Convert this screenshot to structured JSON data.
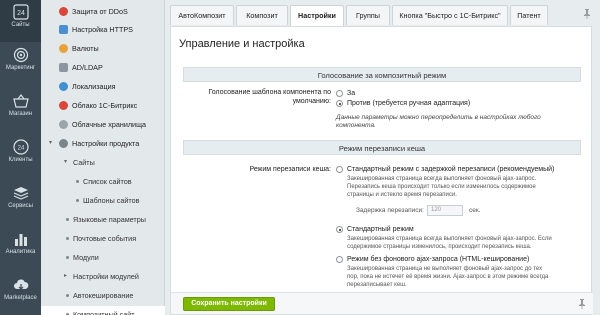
{
  "rail": {
    "items": [
      {
        "label": "Сайты",
        "icon": "grid-24-icon"
      },
      {
        "label": "Маркетинг",
        "icon": "target-icon"
      },
      {
        "label": "Магазин",
        "icon": "basket-icon"
      },
      {
        "label": "Клиенты",
        "icon": "clients-24-icon"
      },
      {
        "label": "Сервисы",
        "icon": "layers-icon"
      },
      {
        "label": "Аналитика",
        "icon": "bar-chart-icon"
      },
      {
        "label": "Marketplace",
        "icon": "cloud-download-icon"
      }
    ],
    "badge_24": "24"
  },
  "menu": {
    "items": [
      {
        "label": "Защита от DDoS"
      },
      {
        "label": "Настройка HTTPS"
      },
      {
        "label": "Валюты"
      },
      {
        "label": "AD/LDAP"
      },
      {
        "label": "Локализация"
      },
      {
        "label": "Облако 1С-Битрикс"
      },
      {
        "label": "Облачные хранилища"
      },
      {
        "label": "Настройки продукта"
      },
      {
        "label": "Сайты"
      },
      {
        "label": "Список сайтов"
      },
      {
        "label": "Шаблоны сайтов"
      },
      {
        "label": "Языковые параметры"
      },
      {
        "label": "Почтовые события"
      },
      {
        "label": "Модули"
      },
      {
        "label": "Настройки модулей"
      },
      {
        "label": "Автокеширование"
      },
      {
        "label": "Композитный сайт"
      }
    ]
  },
  "tabs": [
    {
      "label": "АвтоКомпозит"
    },
    {
      "label": "Композит"
    },
    {
      "label": "Настройки"
    },
    {
      "label": "Группы"
    },
    {
      "label": "Кнопка \"Быстро с 1С-Битрикс\""
    },
    {
      "label": "Патент"
    }
  ],
  "panel": {
    "title": "Управление и настройка",
    "section1": "Голосование за композитный режим",
    "vote_label_1": "Голосование шаблона компонента по",
    "vote_label_2": "умолчанию:",
    "vote_opt_yes": "За",
    "vote_opt_no": "Против (требуется ручная адаптация)",
    "vote_hint_1": "Данные параметры можно переопределить в настройках любого",
    "vote_hint_2": "компонента.",
    "section2": "Режим перезаписи кеша",
    "cache_label": "Режим перезаписи кеша:",
    "opt1": "Стандартный режим с задержкой перезаписи (рекомендуемый)",
    "opt1_hint_1": "Закешированная страница всегда выполняет фоновый ajax-запрос.",
    "opt1_hint_2": "Перезапись кеша происходит только если изменилось содержимое",
    "opt1_hint_3": "страницы и истекло время перезаписи.",
    "delay_label": "Задержка перезаписи:",
    "delay_value": "120",
    "delay_unit": "сек.",
    "opt2": "Стандартный режим",
    "opt2_hint_1": "Закешированная страница всегда выполняет фоновый ajax-запрос. Если",
    "opt2_hint_2": "содержимое страницы изменилось, происходит перезапись кеша.",
    "opt3": "Режим без фонового ajax-запроса (HTML-кеширование)",
    "opt3_hint_1": "Закешированная страница не выполняет фоновый ajax-запрос до тех",
    "opt3_hint_2": "пор, пока не истечет её время жизни. Ajax-запрос в этом режиме всегда",
    "opt3_hint_3": "перезаписывает кеш."
  },
  "footer": {
    "save_label": "Сохранить настройки"
  },
  "colors": {
    "rail_bg": "#3b4a55",
    "accent_green": "#7fb800",
    "menu_bg": "#e3e8eb"
  }
}
